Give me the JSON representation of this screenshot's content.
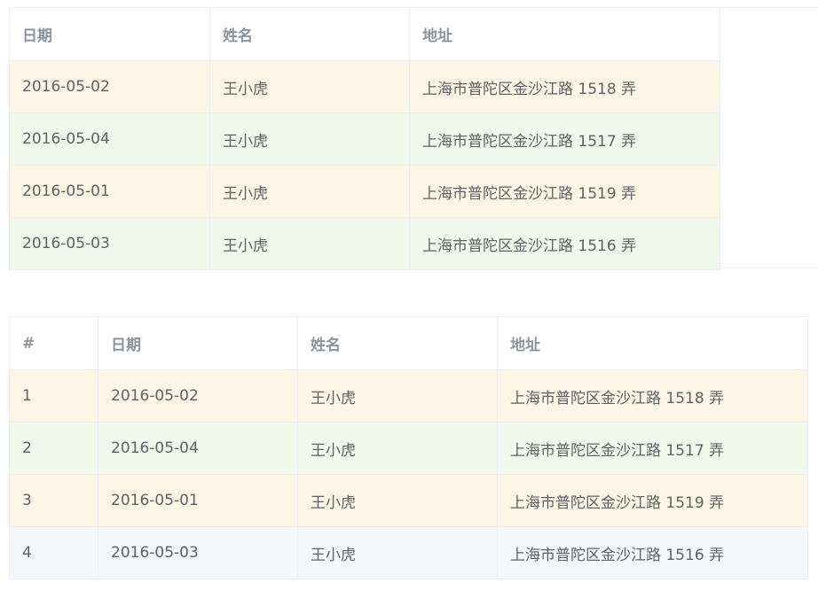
{
  "table1": {
    "headers": {
      "date": "日期",
      "name": "姓名",
      "address": "地址"
    },
    "rows": [
      {
        "date": "2016-05-02",
        "name": "王小虎",
        "address": "上海市普陀区金沙江路 1518 弄",
        "status": "warning"
      },
      {
        "date": "2016-05-04",
        "name": "王小虎",
        "address": "上海市普陀区金沙江路 1517 弄",
        "status": "success"
      },
      {
        "date": "2016-05-01",
        "name": "王小虎",
        "address": "上海市普陀区金沙江路 1519 弄",
        "status": "warning"
      },
      {
        "date": "2016-05-03",
        "name": "王小虎",
        "address": "上海市普陀区金沙江路 1516 弄",
        "status": "success"
      }
    ]
  },
  "table2": {
    "headers": {
      "index": "#",
      "date": "日期",
      "name": "姓名",
      "address": "地址"
    },
    "rows": [
      {
        "index": "1",
        "date": "2016-05-02",
        "name": "王小虎",
        "address": "上海市普陀区金沙江路 1518 弄",
        "status": "warning"
      },
      {
        "index": "2",
        "date": "2016-05-04",
        "name": "王小虎",
        "address": "上海市普陀区金沙江路 1517 弄",
        "status": "success"
      },
      {
        "index": "3",
        "date": "2016-05-01",
        "name": "王小虎",
        "address": "上海市普陀区金沙江路 1519 弄",
        "status": "warning"
      },
      {
        "index": "4",
        "date": "2016-05-03",
        "name": "王小虎",
        "address": "上海市普陀区金沙江路 1516 弄",
        "status": "default"
      }
    ]
  },
  "colors": {
    "header_text": "#909399",
    "cell_text": "#606266",
    "border": "#ebeef5",
    "warning_row": "#fdf5e6",
    "success_row": "#f0f9eb",
    "default_row": "#f5f7fa"
  }
}
